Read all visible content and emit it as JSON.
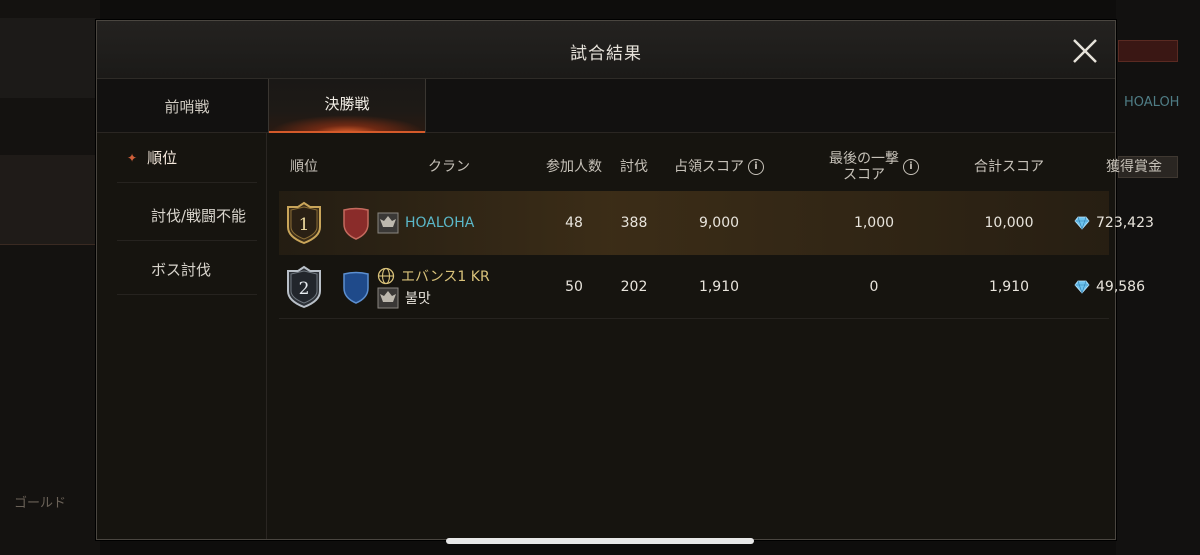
{
  "modal": {
    "title": "試合結果"
  },
  "tabs": [
    {
      "label": "前哨戦"
    },
    {
      "label": "決勝戦"
    }
  ],
  "side_menu": [
    {
      "label": "順位"
    },
    {
      "label": "討伐/戦闘不能"
    },
    {
      "label": "ボス討伐"
    }
  ],
  "table": {
    "headers": {
      "rank": "順位",
      "clan": "クラン",
      "participants": "参加人数",
      "kills": "討伐",
      "occupation": "占領スコア",
      "last_hit_1": "最後の一撃",
      "last_hit_2": "スコア",
      "total": "合計スコア",
      "reward": "獲得賞金"
    },
    "rows": [
      {
        "rank": "1",
        "clan_name": "HOALOHA",
        "participants": "48",
        "kills": "388",
        "occupation": "9,000",
        "last_hit": "1,000",
        "total": "10,000",
        "reward": "723,423"
      },
      {
        "rank": "2",
        "clan_server": "エバンス1 KR",
        "clan_name": "불맛",
        "participants": "50",
        "kills": "202",
        "occupation": "1,910",
        "last_hit": "0",
        "total": "1,910",
        "reward": "49,586"
      }
    ]
  },
  "background": {
    "gold_label": "ゴールド",
    "right_label": "HOALOH"
  },
  "colors": {
    "accent_orange": "#d45a2a",
    "clan_cyan": "#5bb8c9",
    "server_gold": "#d9c27a"
  }
}
